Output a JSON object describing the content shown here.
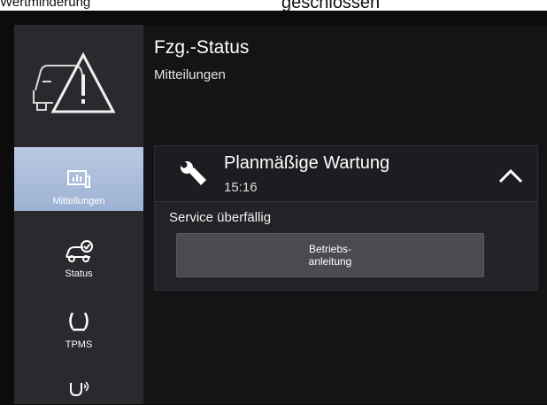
{
  "top_strip": {
    "left_text": "Wertminderung",
    "center_text": "geschlossen"
  },
  "header": {
    "title": "Fzg.-Status",
    "subtitle": "Mitteilungen"
  },
  "sidebar": {
    "app_icon": "vehicle-warning-icon",
    "items": [
      {
        "label": "Mitteilungen",
        "icon": "messages-icon",
        "active": true
      },
      {
        "label": "Status",
        "icon": "car-check-icon",
        "active": false
      },
      {
        "label": "TPMS",
        "icon": "tire-pressure-icon",
        "active": false
      },
      {
        "label": "",
        "icon": "connected-service-icon",
        "active": false
      }
    ]
  },
  "message_card": {
    "icon": "wrench-icon",
    "title": "Planmäßige Wartung",
    "time": "15:16",
    "expanded": true,
    "detail": "Service überfällig",
    "button_label": "Betriebs-\nanleitung"
  },
  "colors": {
    "sidebar_bg": "#2a2a2e",
    "active_item_bg": "#a9bcda",
    "main_bg": "#141416",
    "card_bg": "#232327",
    "button_bg": "#4a4a4f"
  }
}
